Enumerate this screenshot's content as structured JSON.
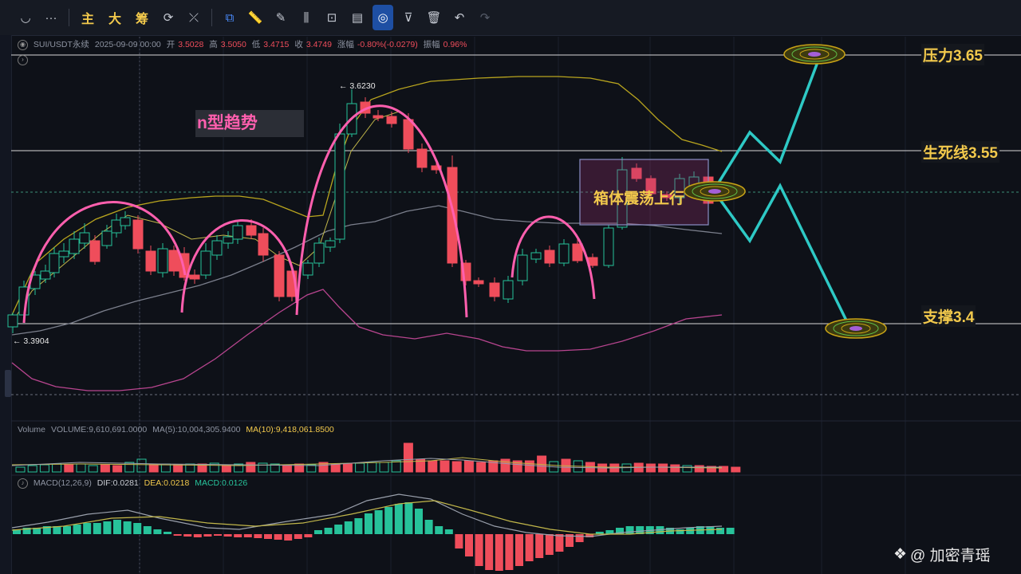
{
  "toolbar": {
    "items": [
      {
        "name": "curve-tool-icon",
        "label": "◡",
        "kind": "icon"
      },
      {
        "name": "more-icon",
        "label": "···",
        "kind": "icon"
      },
      {
        "name": "sep"
      },
      {
        "name": "indicator-main-button",
        "label": "主",
        "kind": "ind"
      },
      {
        "name": "indicator-big-button",
        "label": "大",
        "kind": "ind"
      },
      {
        "name": "indicator-chips-button",
        "label": "筹",
        "kind": "ind"
      },
      {
        "name": "auto-refresh-icon",
        "label": "⟳",
        "kind": "icon"
      },
      {
        "name": "hide-drawings-icon",
        "label": "⤫",
        "kind": "icon"
      },
      {
        "name": "sep"
      },
      {
        "name": "copy-icon",
        "label": "⧉",
        "kind": "icon",
        "accent": true
      },
      {
        "name": "ruler-icon",
        "label": "📏",
        "kind": "icon"
      },
      {
        "name": "brush-icon",
        "label": "✎",
        "kind": "icon"
      },
      {
        "name": "candles-icon",
        "label": "⫼",
        "kind": "icon"
      },
      {
        "name": "lock-icon",
        "label": "⊡",
        "kind": "icon"
      },
      {
        "name": "note-icon",
        "label": "▤",
        "kind": "icon"
      },
      {
        "name": "magnet-icon",
        "label": "◎",
        "kind": "icon",
        "active": true
      },
      {
        "name": "filter-icon",
        "label": "⊽",
        "kind": "icon"
      },
      {
        "name": "trash-icon",
        "label": "🗑",
        "kind": "icon"
      },
      {
        "name": "undo-icon",
        "label": "↶",
        "kind": "icon"
      },
      {
        "name": "redo-icon",
        "label": "↷",
        "kind": "icon",
        "dim": true
      }
    ]
  },
  "ohlc": {
    "symbol": "SUI/USDT永续",
    "datetime": "2025-09-09 00:00",
    "open_label": "开",
    "open": "3.5028",
    "high_label": "高",
    "high": "3.5050",
    "low_label": "低",
    "low": "3.4715",
    "close_label": "收",
    "close": "3.4749",
    "change_label": "涨幅",
    "change": "-0.80%(-0.0279)",
    "amp_label": "振幅",
    "amp": "0.96%"
  },
  "volume": {
    "title": "Volume",
    "value": "VOLUME:9,610,691.0000",
    "ma5": "MA(5):10,004,305.9400",
    "ma10": "MA(10):9,418,061.8500"
  },
  "macd": {
    "title": "MACD(12,26,9)",
    "dif": "DIF:0.0281",
    "dea": "DEA:0.0218",
    "macd": "MACD:0.0126"
  },
  "annotations": {
    "high_marker": "3.6230",
    "low_marker": "3.3904",
    "trend_label": "n型趋势",
    "box_label": "箱体震荡上行",
    "resistance": "压力3.65",
    "pivot": "生死线3.55",
    "support": "支撑3.4"
  },
  "colors": {
    "up": "#27c29a",
    "down": "#ef4d5b",
    "accent": "#f2c94c",
    "arc": "#ff5fae",
    "projection": "#2ec9c5"
  },
  "watermark": "@ 加密青瑶"
}
